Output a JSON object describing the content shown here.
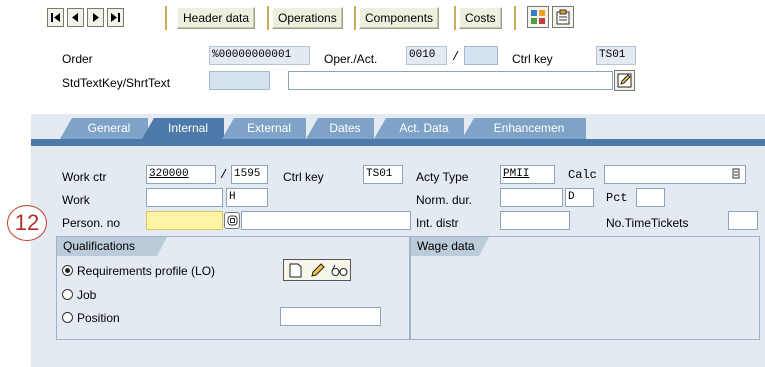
{
  "toolbar": {
    "buttons": [
      "Header data",
      "Operations",
      "Components",
      "Costs"
    ]
  },
  "header": {
    "order_label": "Order",
    "order_value": "%00000000001",
    "oper_label": "Oper./Act.",
    "oper_value": "0010",
    "oper_sep": "/",
    "ctrl_key_label": "Ctrl key",
    "ctrl_key_value": "TS01",
    "stdtext_label": "StdTextKey/ShrtText",
    "stdtext_value": "",
    "shorttext_value": ""
  },
  "tabs": [
    "General",
    "Internal",
    "External",
    "Dates",
    "Act. Data",
    "Enhancemen"
  ],
  "active_tab": "Internal",
  "internal": {
    "work_ctr_label": "Work ctr",
    "work_ctr_value": "320000",
    "plant_sep": "/",
    "plant_value": "1595",
    "ctrl_key_label": "Ctrl key",
    "ctrl_key_value": "TS01",
    "acty_type_label": "Acty Type",
    "acty_type_value": "PMII",
    "calc_label": "Calc",
    "calc_value": "",
    "work_label": "Work",
    "work_value": "",
    "work_unit": "H",
    "norm_dur_label": "Norm. dur.",
    "norm_dur_value": "",
    "norm_dur_unit": "D",
    "pct_label": "Pct",
    "pct_value": "",
    "person_no_label": "Person. no",
    "person_no_value": "",
    "person_name": "",
    "int_distr_label": "Int. distr",
    "int_distr_value": "",
    "no_timetickets_label": "No.TimeTickets",
    "no_timetickets_value": ""
  },
  "qualifications": {
    "title": "Qualifications",
    "options": [
      "Requirements profile (LO)",
      "Job",
      "Position"
    ],
    "selected": "Requirements profile (LO)",
    "position_value": ""
  },
  "wage": {
    "title": "Wage data"
  },
  "callout": {
    "number": "12"
  },
  "colors": {
    "screen_bg": "#e3eaf2",
    "tab_active": "#4d7aa8",
    "tab_inactive": "#7fa3c6",
    "required_field": "#fff3a6",
    "callout": "#c0392b"
  }
}
